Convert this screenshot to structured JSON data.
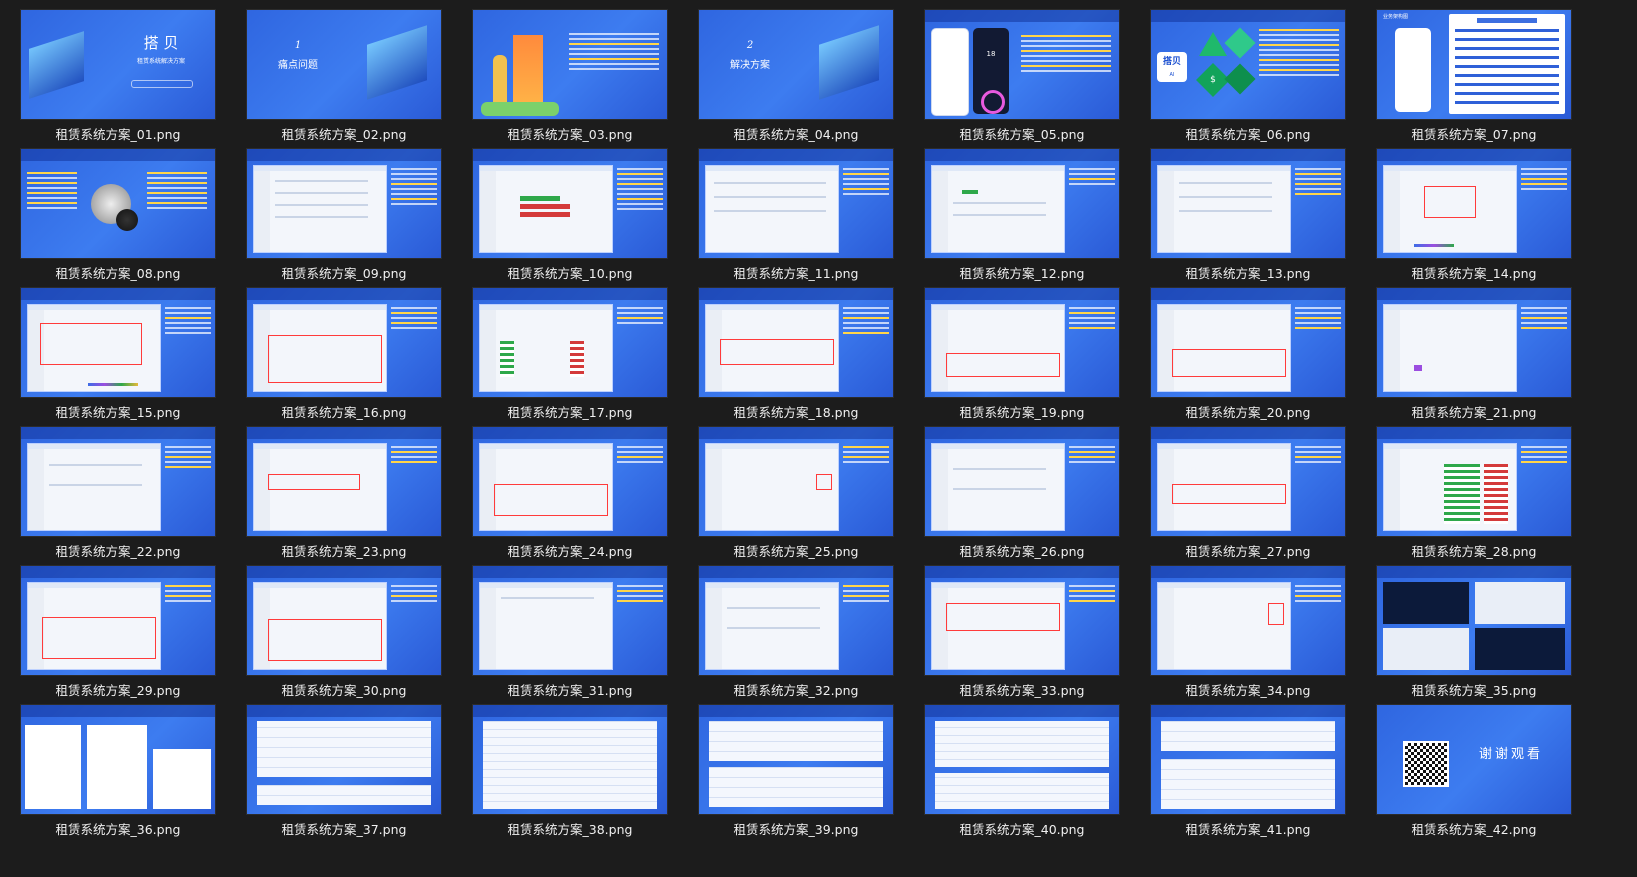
{
  "files": [
    {
      "name": "租赁系统方案_01.png"
    },
    {
      "name": "租赁系统方案_02.png"
    },
    {
      "name": "租赁系统方案_03.png"
    },
    {
      "name": "租赁系统方案_04.png"
    },
    {
      "name": "租赁系统方案_05.png"
    },
    {
      "name": "租赁系统方案_06.png"
    },
    {
      "name": "租赁系统方案_07.png"
    },
    {
      "name": "租赁系统方案_08.png"
    },
    {
      "name": "租赁系统方案_09.png"
    },
    {
      "name": "租赁系统方案_10.png"
    },
    {
      "name": "租赁系统方案_11.png"
    },
    {
      "name": "租赁系统方案_12.png"
    },
    {
      "name": "租赁系统方案_13.png"
    },
    {
      "name": "租赁系统方案_14.png"
    },
    {
      "name": "租赁系统方案_15.png"
    },
    {
      "name": "租赁系统方案_16.png"
    },
    {
      "name": "租赁系统方案_17.png"
    },
    {
      "name": "租赁系统方案_18.png"
    },
    {
      "name": "租赁系统方案_19.png"
    },
    {
      "name": "租赁系统方案_20.png"
    },
    {
      "name": "租赁系统方案_21.png"
    },
    {
      "name": "租赁系统方案_22.png"
    },
    {
      "name": "租赁系统方案_23.png"
    },
    {
      "name": "租赁系统方案_24.png"
    },
    {
      "name": "租赁系统方案_25.png"
    },
    {
      "name": "租赁系统方案_26.png"
    },
    {
      "name": "租赁系统方案_27.png"
    },
    {
      "name": "租赁系统方案_28.png"
    },
    {
      "name": "租赁系统方案_29.png"
    },
    {
      "name": "租赁系统方案_30.png"
    },
    {
      "name": "租赁系统方案_31.png"
    },
    {
      "name": "租赁系统方案_32.png"
    },
    {
      "name": "租赁系统方案_33.png"
    },
    {
      "name": "租赁系统方案_34.png"
    },
    {
      "name": "租赁系统方案_35.png"
    },
    {
      "name": "租赁系统方案_36.png"
    },
    {
      "name": "租赁系统方案_37.png"
    },
    {
      "name": "租赁系统方案_38.png"
    },
    {
      "name": "租赁系统方案_39.png"
    },
    {
      "name": "租赁系统方案_40.png"
    },
    {
      "name": "租赁系统方案_41.png"
    },
    {
      "name": "租赁系统方案_42.png"
    }
  ],
  "slides": {
    "s01_title": "搭 贝",
    "s01_sub": "租赁系统解决方案",
    "s02_num": "1",
    "s02_title": "痛点问题",
    "s04_num": "2",
    "s04_title": "解决方案",
    "s05_time": "18",
    "s06_brand": "搭贝",
    "s06_ai": "AI",
    "s06_dollar": "$",
    "s07_title": "业务架构图",
    "s42_title": "谢谢观看"
  },
  "colors": {
    "slide_bg": "#3d7cf0",
    "accent_yellow": "#ffd54a",
    "highlight_red": "#ff3b3b",
    "window_bg": "#1c1c1c"
  }
}
